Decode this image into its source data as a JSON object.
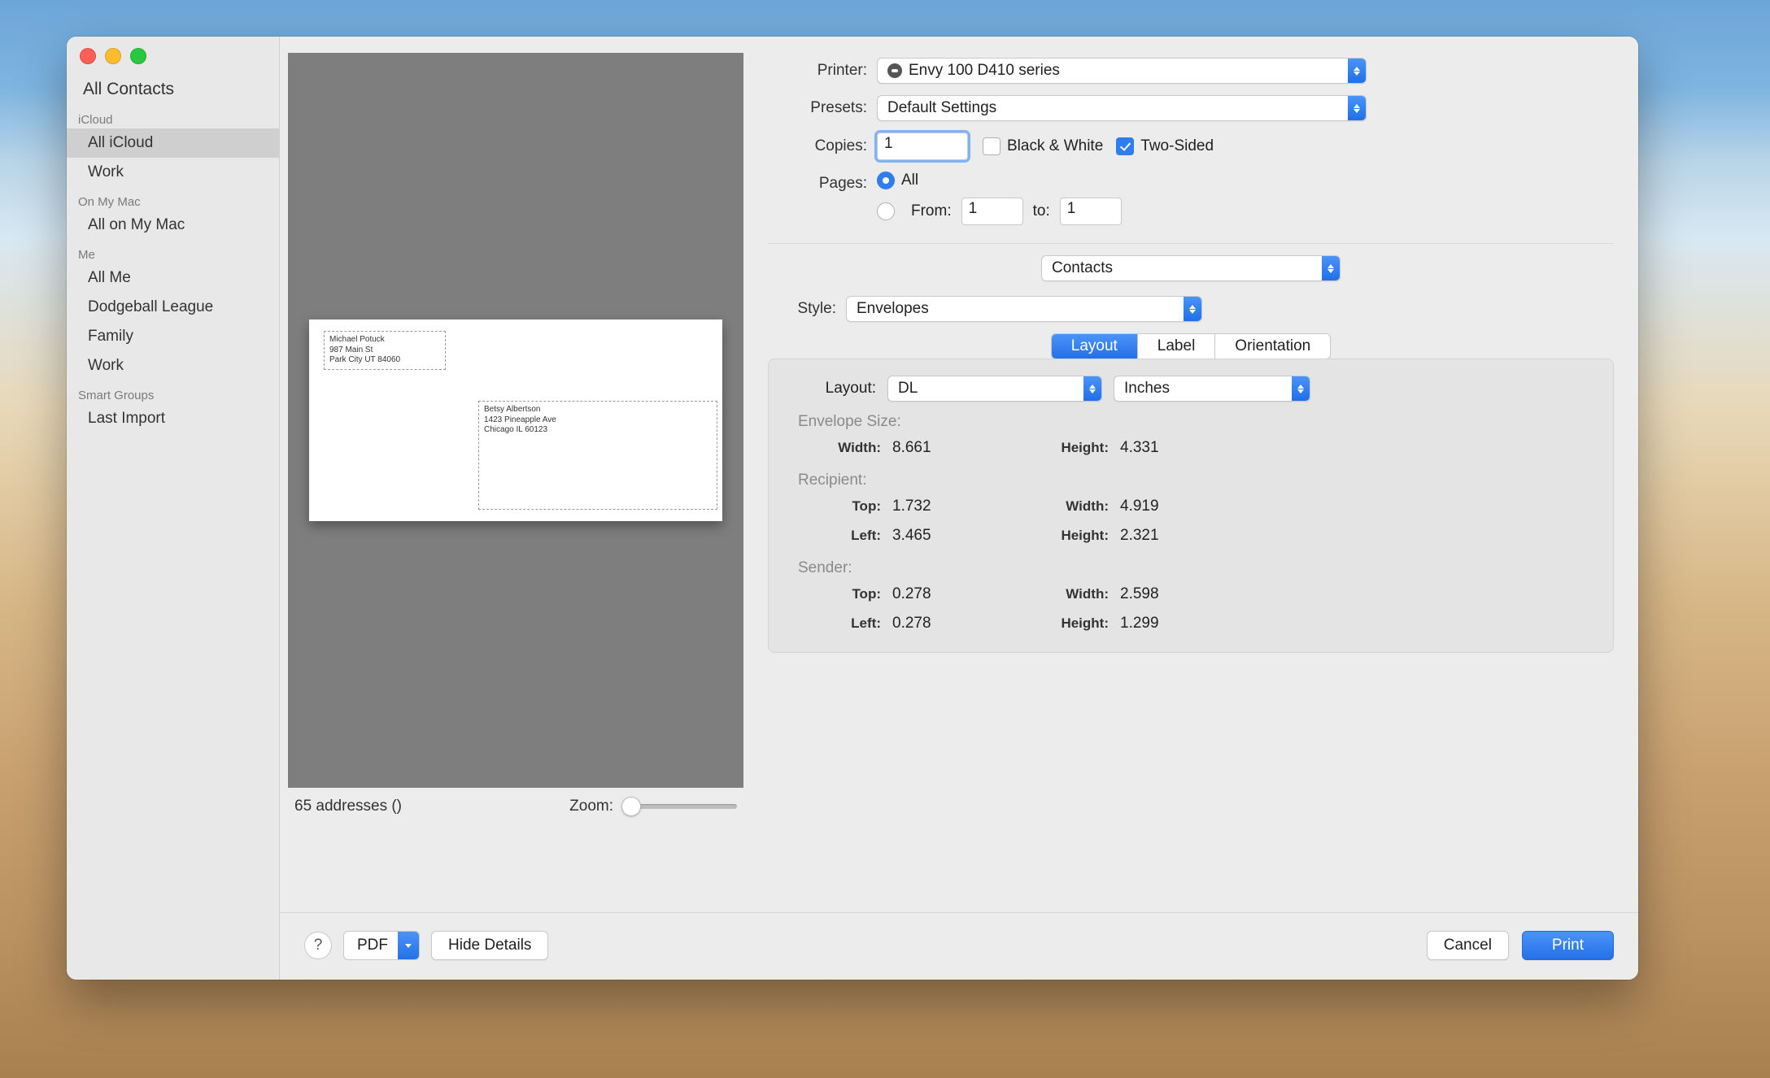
{
  "sidebar": {
    "top": "All Contacts",
    "groups": [
      {
        "label": "iCloud",
        "items": [
          "All iCloud",
          "Work"
        ],
        "selected": 0
      },
      {
        "label": "On My Mac",
        "items": [
          "All on My Mac"
        ]
      },
      {
        "label": "Me",
        "items": [
          "All Me",
          "Dodgeball League",
          "Family",
          "Work"
        ]
      },
      {
        "label": "Smart Groups",
        "items": [
          "Last Import"
        ]
      }
    ]
  },
  "preview": {
    "sender": {
      "name": "Michael Potuck",
      "street": "987 Main St",
      "city": "Park City UT 84060"
    },
    "recipient": {
      "name": "Betsy Albertson",
      "street": "1423 Pineapple Ave",
      "city": "Chicago IL 60123"
    },
    "status": "65 addresses ()",
    "zoom_label": "Zoom:"
  },
  "print": {
    "printer_label": "Printer:",
    "printer_value": "Envy 100 D410 series",
    "presets_label": "Presets:",
    "presets_value": "Default Settings",
    "copies_label": "Copies:",
    "copies_value": "1",
    "bw_label": "Black & White",
    "bw_checked": false,
    "two_sided_label": "Two-Sided",
    "two_sided_checked": true,
    "pages_label": "Pages:",
    "pages_all": "All",
    "pages_from_label": "From:",
    "pages_from": "1",
    "pages_to_label": "to:",
    "pages_to": "1",
    "app_section": "Contacts",
    "style_label": "Style:",
    "style_value": "Envelopes",
    "tabs": [
      "Layout",
      "Label",
      "Orientation"
    ],
    "layout": {
      "label": "Layout:",
      "size": "DL",
      "unit": "Inches",
      "envelope_size_label": "Envelope Size:",
      "width_label": "Width:",
      "height_label": "Height:",
      "env_width": "8.661",
      "env_height": "4.331",
      "recipient_label": "Recipient:",
      "top_label": "Top:",
      "left_label": "Left:",
      "rec_top": "1.732",
      "rec_width": "4.919",
      "rec_left": "3.465",
      "rec_height": "2.321",
      "sender_label": "Sender:",
      "sen_top": "0.278",
      "sen_width": "2.598",
      "sen_left": "0.278",
      "sen_height": "1.299"
    }
  },
  "footer": {
    "pdf": "PDF",
    "hide_details": "Hide Details",
    "cancel": "Cancel",
    "print": "Print"
  }
}
